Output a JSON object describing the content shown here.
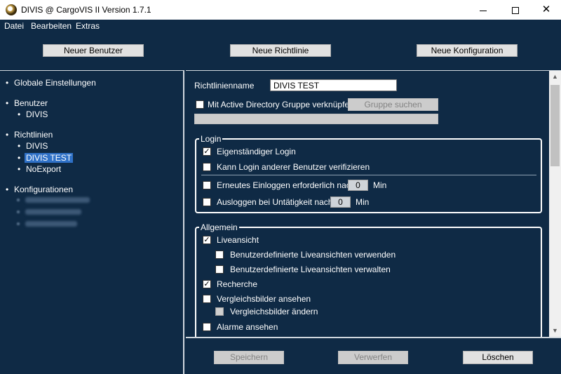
{
  "window": {
    "title": "DIVIS @ CargoVIS II Version 1.7.1",
    "minimize": "",
    "maximize": "",
    "close": "✕"
  },
  "menu": [
    "Datei",
    "Bearbeiten",
    "Extras"
  ],
  "toolbar": {
    "new_user": "Neuer Benutzer",
    "new_policy": "Neue Richtlinie",
    "new_config": "Neue Konfiguration"
  },
  "tree": {
    "global": "Globale Einstellungen",
    "users_header": "Benutzer",
    "users": [
      "DIVIS"
    ],
    "policies_header": "Richtlinien",
    "policies": [
      "DIVIS",
      "DIVIS TEST",
      "NoExport"
    ],
    "selected_policy": "DIVIS TEST",
    "configs_header": "Konfigurationen"
  },
  "form": {
    "policy_name_label": "Richtlinienname",
    "policy_name_value": "DIVIS TEST",
    "ad_link_label": "Mit Active Directory Gruppe verknüpfen",
    "ad_link_checked": false,
    "group_search_button": "Gruppe suchen",
    "group_field_value": ""
  },
  "login": {
    "title": "Login",
    "own_login": "Eigenständiger Login",
    "own_login_checked": true,
    "verify_other": "Kann Login anderer Benutzer verifizieren",
    "verify_other_checked": false,
    "relogin": "Erneutes Einloggen erforderlich nach",
    "relogin_checked": false,
    "relogin_value": "0",
    "relogin_unit": "Min",
    "logout_idle": "Ausloggen bei Untätigkeit nach",
    "logout_idle_checked": false,
    "logout_idle_value": "0",
    "logout_idle_unit": "Min"
  },
  "general": {
    "title": "Allgemein",
    "live": "Liveansicht",
    "live_checked": true,
    "live_custom_use": "Benutzerdefinierte Liveansichten verwenden",
    "live_custom_manage": "Benutzerdefinierte Liveansichten verwalten",
    "research": "Recherche",
    "research_checked": true,
    "compare_view": "Vergleichsbilder ansehen",
    "compare_edit": "Vergleichsbilder ändern",
    "alarms_view": "Alarme ansehen"
  },
  "actions": {
    "save": "Speichern",
    "discard": "Verwerfen",
    "delete": "Löschen"
  },
  "icons": {
    "check": "✓"
  }
}
